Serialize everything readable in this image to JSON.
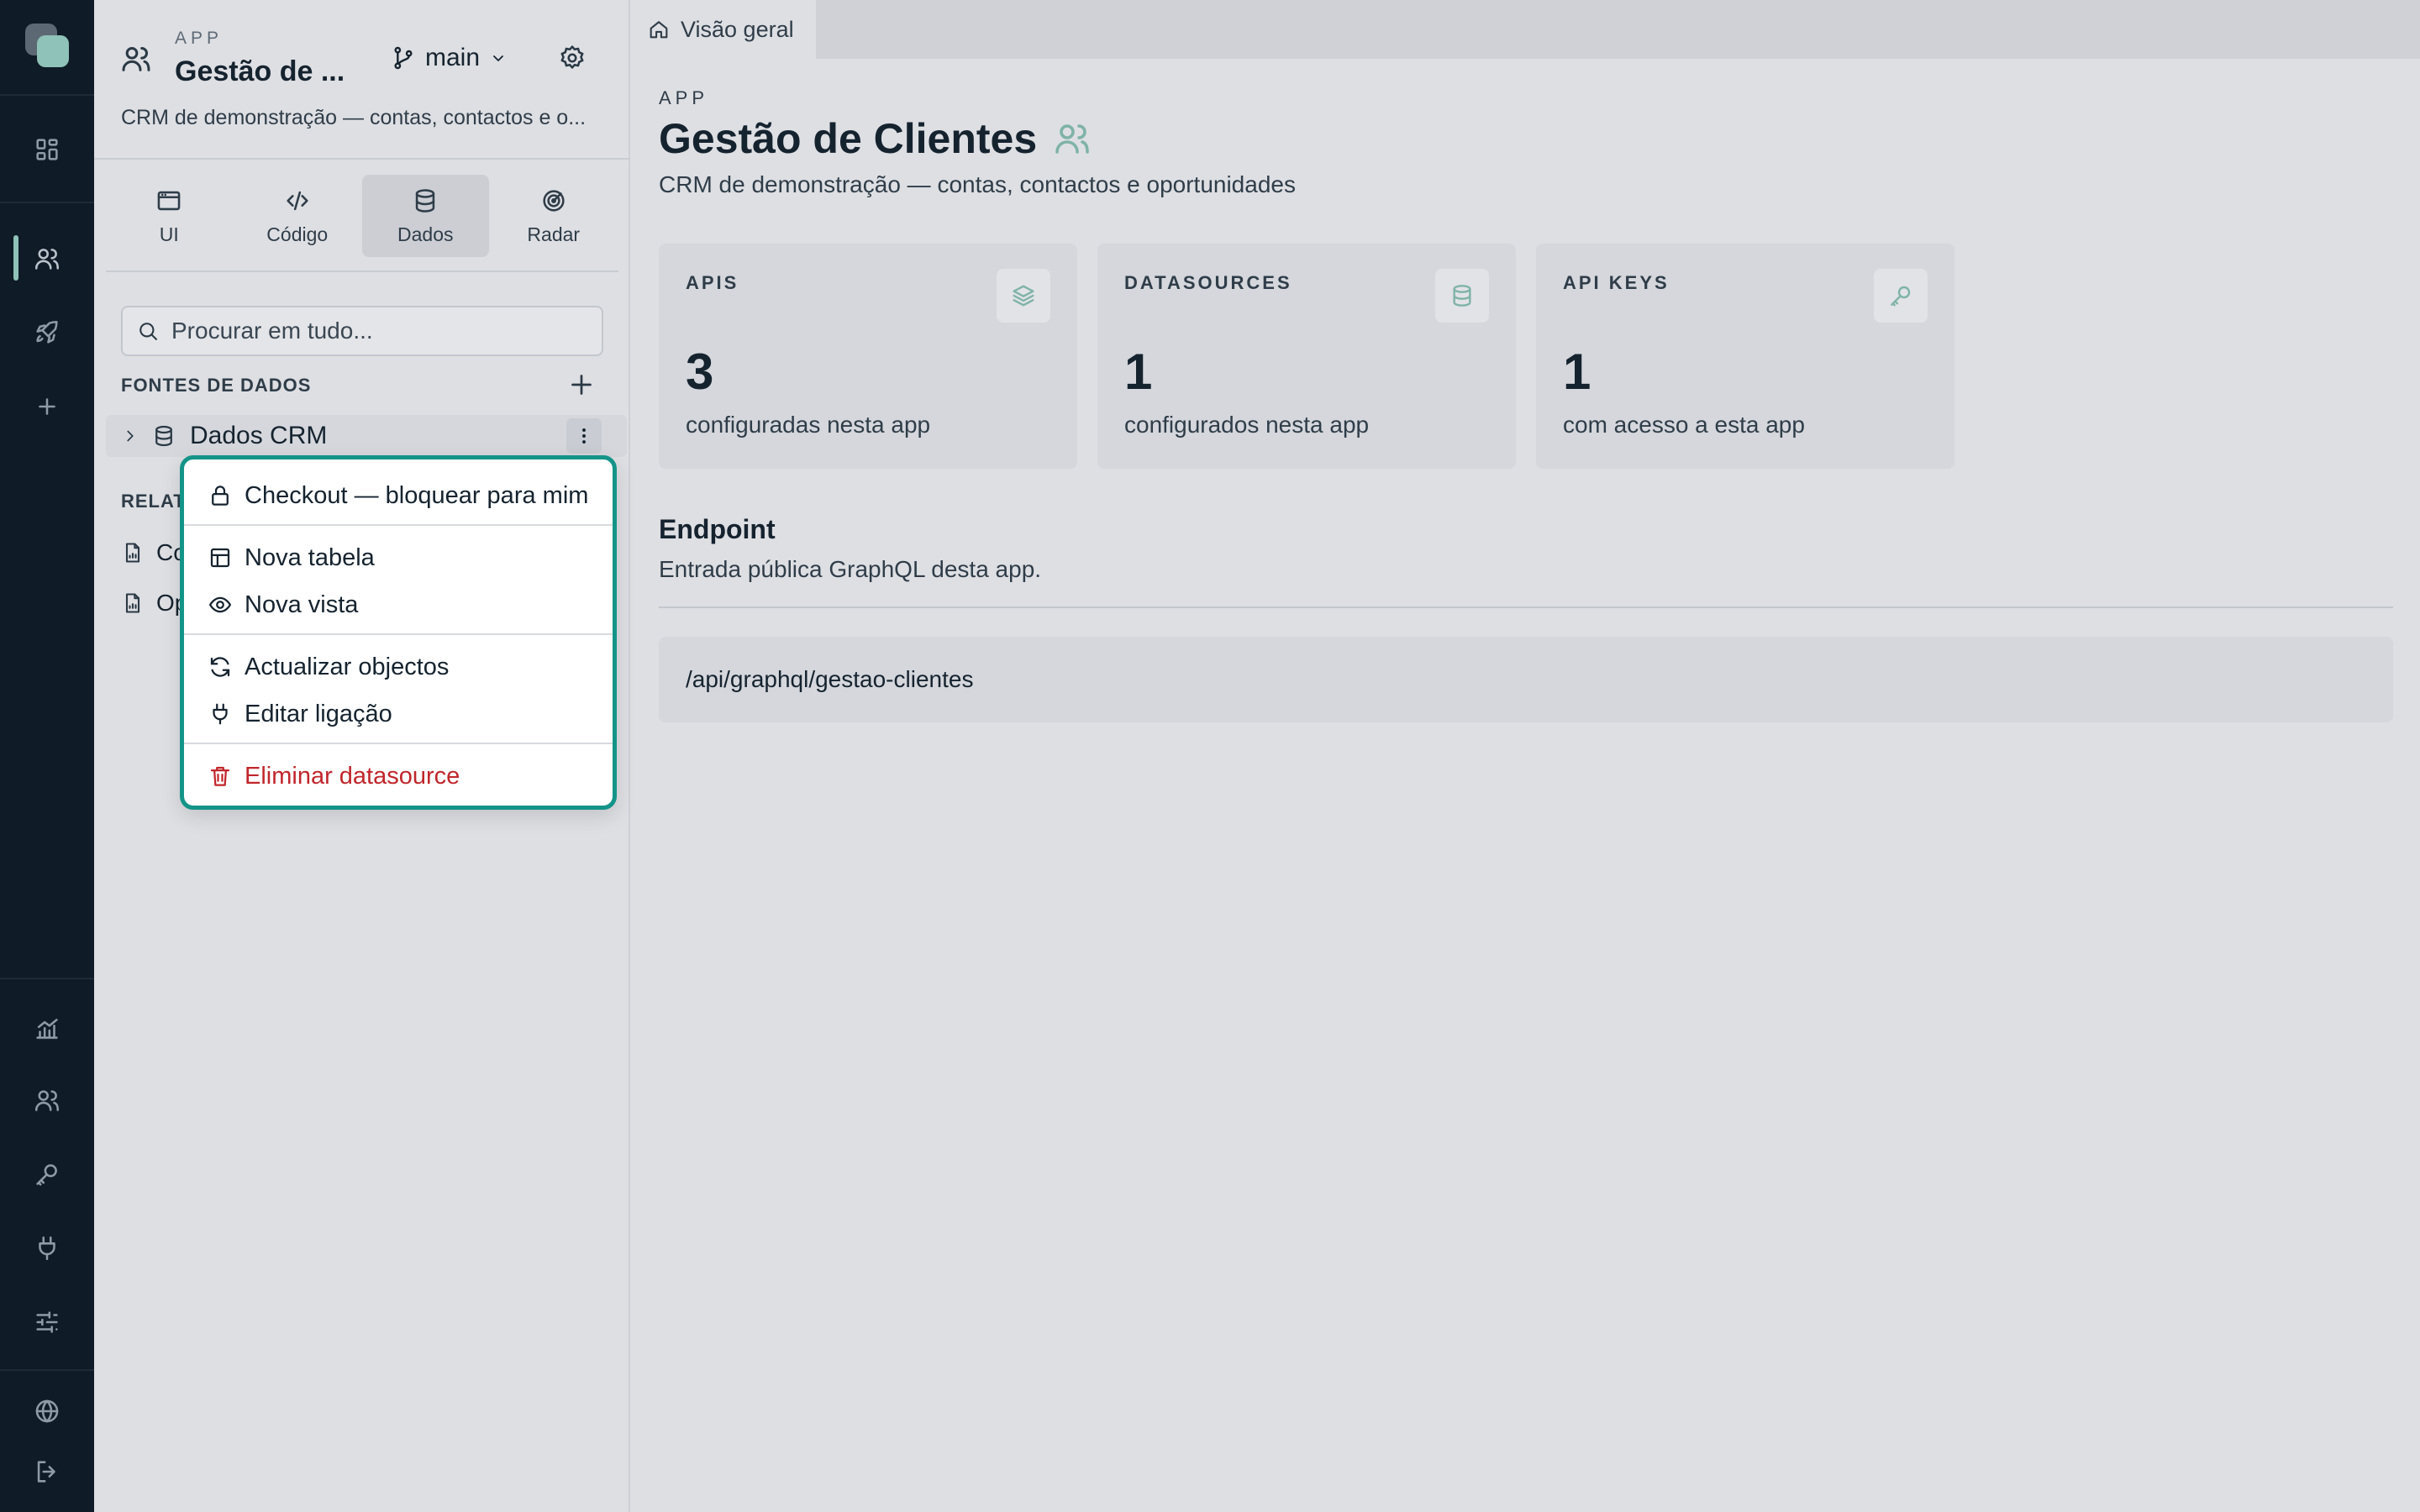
{
  "rail": {
    "icons": [
      "dashboard-icon",
      "users-icon",
      "rocket-icon",
      "plus-icon",
      "analytics-icon",
      "team-icon",
      "key-icon",
      "plug-icon",
      "sliders-icon",
      "globe-icon",
      "logout-icon"
    ]
  },
  "app": {
    "eyebrow": "APP",
    "title_short": "Gestão de ...",
    "branch": "main",
    "description_short": "CRM de demonstração — contas, contactos e o..."
  },
  "tabs": [
    {
      "label": "UI",
      "icon": "window-icon"
    },
    {
      "label": "Código",
      "icon": "code-icon"
    },
    {
      "label": "Dados",
      "icon": "database-icon",
      "active": true
    },
    {
      "label": "Radar",
      "icon": "radar-icon"
    }
  ],
  "search": {
    "placeholder": "Procurar em tudo..."
  },
  "datasources": {
    "label": "FONTES DE DADOS",
    "items": [
      {
        "label": "Dados CRM"
      }
    ]
  },
  "reports": {
    "label": "RELATÓ",
    "items": [
      {
        "label": "Co"
      },
      {
        "label": "Op"
      }
    ]
  },
  "context_menu": {
    "items": [
      {
        "label": "Checkout — bloquear para mim",
        "icon": "lock-icon"
      },
      {
        "label": "Nova tabela",
        "icon": "table-icon"
      },
      {
        "label": "Nova vista",
        "icon": "eye-icon"
      },
      {
        "label": "Actualizar objectos",
        "icon": "refresh-icon"
      },
      {
        "label": "Editar ligação",
        "icon": "plug-icon"
      },
      {
        "label": "Eliminar datasource",
        "icon": "trash-icon",
        "danger": true
      }
    ]
  },
  "main": {
    "tab_label": "Visão geral",
    "eyebrow": "APP",
    "title": "Gestão de Clientes",
    "description": "CRM de demonstração — contas, contactos e oportunidades",
    "cards": [
      {
        "title": "APIS",
        "value": "3",
        "subtitle": "configuradas nesta app",
        "icon": "layers-icon"
      },
      {
        "title": "DATASOURCES",
        "value": "1",
        "subtitle": "configurados nesta app",
        "icon": "database-icon"
      },
      {
        "title": "API KEYS",
        "value": "1",
        "subtitle": "com acesso a esta app",
        "icon": "key-icon"
      }
    ],
    "endpoint": {
      "title": "Endpoint",
      "description": "Entrada pública GraphQL desta app.",
      "path": "/api/graphql/gestao-clientes"
    }
  },
  "colors": {
    "rail_bg": "#0f1b26",
    "accent": "#149488",
    "accent_soft": "#8fc2b8",
    "danger": "#c0262b",
    "surface": "#dedfe3"
  }
}
